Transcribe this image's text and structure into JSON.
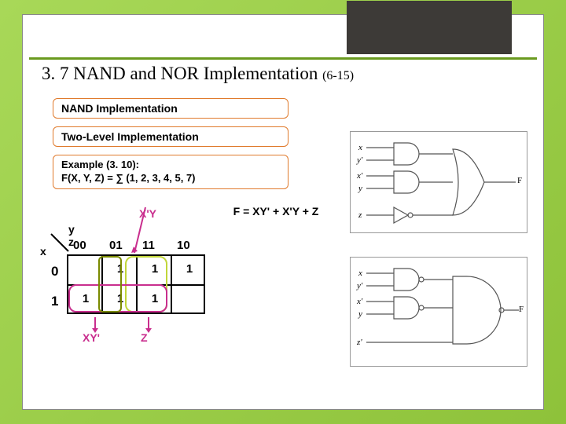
{
  "title": {
    "main": "3. 7 NAND and NOR Implementation ",
    "sub": "(6-15)"
  },
  "pills": {
    "p1": "NAND Implementation",
    "p2": "Two-Level Implementation",
    "p3a": "Example (3. 10):",
    "p3b": "F(X, Y, Z) = ∑ (1, 2, 3, 4, 5, 7)"
  },
  "kmap": {
    "yz": "y z",
    "x": "x",
    "cols": {
      "c00": "00",
      "c01": "01",
      "c11": "11",
      "c10": "10"
    },
    "rows": {
      "r0": "0",
      "r1": "1"
    },
    "cells": {
      "r0c01": "1",
      "r0c11": "1",
      "r0c10": "1",
      "r1c00": "1",
      "r1c01": "1",
      "r1c11": "1"
    },
    "labels": {
      "xy": "X'Y",
      "z": "Z",
      "xyp": "XY'"
    }
  },
  "equation": "F = XY' + X'Y + Z",
  "circuit": {
    "inputs": {
      "x": "x",
      "yp": "y'",
      "xp": "x'",
      "y": "y",
      "z": "z",
      "zp": "z'"
    },
    "output": "F"
  }
}
